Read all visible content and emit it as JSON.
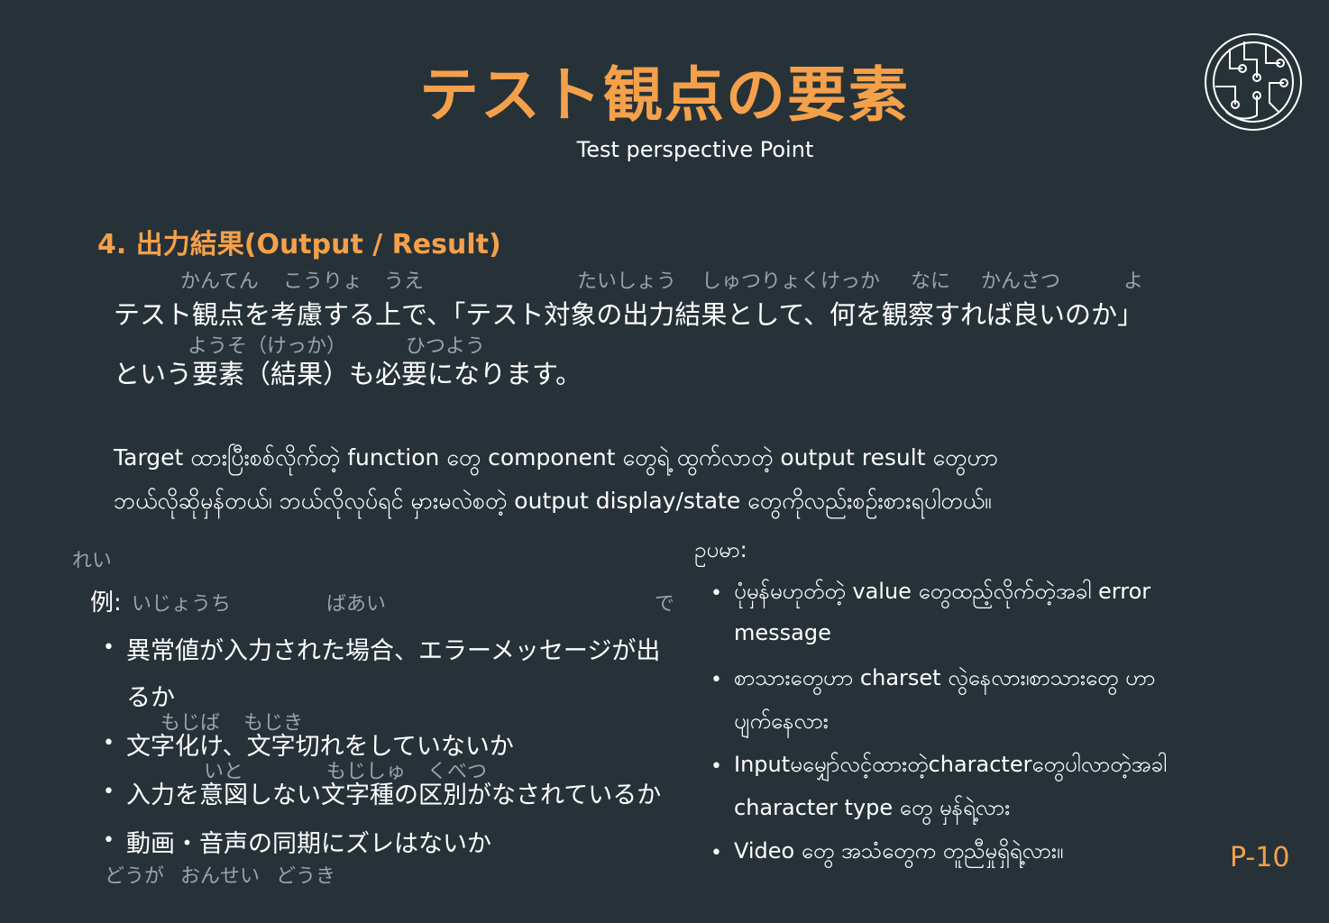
{
  "title": "テスト観点の要素",
  "subtitle": "Test perspective Point",
  "section": {
    "number": "4.",
    "heading": "出力結果(Output / Result)"
  },
  "intro": {
    "ruby_line1": [
      "かんてん",
      "こうりょ",
      "うえ",
      "たいしょう",
      "しゅつりょくけっか",
      "なに",
      "かんさつ",
      "よ"
    ],
    "line1": "テスト観点を考慮する上で、「テスト対象の出力結果として、何を観察すれば良いのか」",
    "ruby_line2": [
      "ようそ（けっか）",
      "ひつよう"
    ],
    "line2": "という要素（結果）も必要になります。"
  },
  "burmese_intro": {
    "line1": "Target ထားပြီးစစ်လိုက်တဲ့ function တွေ component တွေရဲ့ ထွက်လာတဲ့ output result တွေဟာ",
    "line2": "ဘယ်လိုဆိုမှန်တယ်၊ ဘယ်လိုလုပ်ရင် မှားမလဲစတဲ့ output display/state တွေကိုလည်းစဉ်းစားရပါတယ်။"
  },
  "left": {
    "label_ruby": "れい",
    "label": "例:",
    "ruby_row1": [
      "いじょうち",
      "ばあい",
      "で"
    ],
    "items": [
      "異常値が入力された場合、エラーメッセージが出",
      "るか",
      "文字化け、文字切れをしていないか",
      "入力を意図しない文字種の区別がなされているか",
      "動画・音声の同期にズレはないか"
    ],
    "ruby_item2": [
      "もじば",
      "もじき"
    ],
    "ruby_item3": [
      "いと",
      "もじしゅ",
      "くべつ"
    ],
    "ruby_item4": [
      "どうが",
      "おんせい",
      "どうき"
    ]
  },
  "right": {
    "label": "ဥပမာ:",
    "items": [
      "ပုံမှန်မဟုတ်တဲ့ value တွေထည့်လိုက်တဲ့အခါ error",
      "message",
      "စာသားတွေဟာ charset လွဲနေလား၊စာသားတွေ ဟာ",
      "ပျက်နေလား",
      "Inputမမျှော်လင့်ထားတဲ့characterတွေပါလာတဲ့အခါ",
      "character type တွေ မှန်ရဲ့လား",
      "Video တွေ အသံတွေက တူညီမှုရှိရဲ့လား။"
    ]
  },
  "page_number": "P-10",
  "colors": {
    "background": "#263238",
    "accent": "#f5a04a",
    "ruby": "#9aa3a8"
  },
  "icons": {
    "logo": "circuit-circle-logo-icon",
    "bullet": "bullet-dot-icon"
  }
}
